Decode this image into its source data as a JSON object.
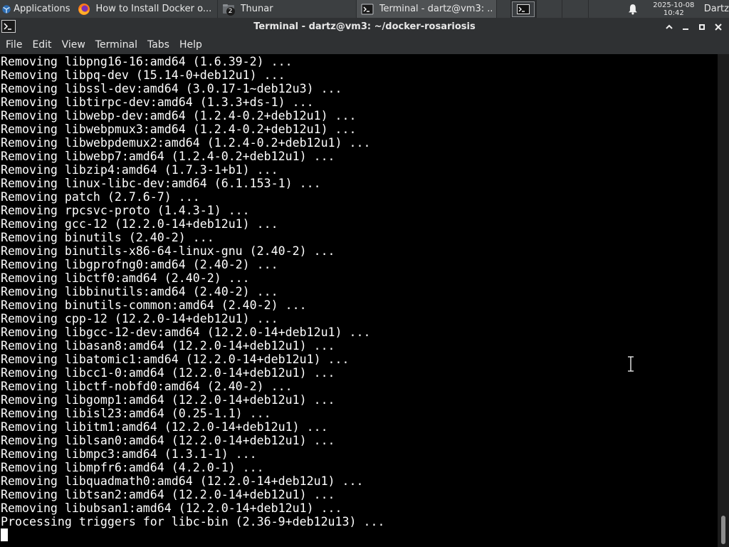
{
  "panel": {
    "applications_label": "Applications",
    "tasks": [
      {
        "label": "How to Install Docker o...",
        "icon": "firefox-icon"
      },
      {
        "label": "Thunar",
        "icon": "file-manager-icon",
        "badge": "2"
      },
      {
        "label": "Terminal - dartz@vm3: ...",
        "icon": "terminal-icon"
      }
    ],
    "date": "2025-10-08",
    "time": "10:42",
    "user": "Dartz"
  },
  "window": {
    "title": "Terminal - dartz@vm3: ~/docker-rosariosis"
  },
  "menu": [
    "File",
    "Edit",
    "View",
    "Terminal",
    "Tabs",
    "Help"
  ],
  "terminal": {
    "lines": [
      "Removing libpng16-16:amd64 (1.6.39-2) ...",
      "Removing libpq-dev (15.14-0+deb12u1) ...",
      "Removing libssl-dev:amd64 (3.0.17-1~deb12u3) ...",
      "Removing libtirpc-dev:amd64 (1.3.3+ds-1) ...",
      "Removing libwebp-dev:amd64 (1.2.4-0.2+deb12u1) ...",
      "Removing libwebpmux3:amd64 (1.2.4-0.2+deb12u1) ...",
      "Removing libwebpdemux2:amd64 (1.2.4-0.2+deb12u1) ...",
      "Removing libwebp7:amd64 (1.2.4-0.2+deb12u1) ...",
      "Removing libzip4:amd64 (1.7.3-1+b1) ...",
      "Removing linux-libc-dev:amd64 (6.1.153-1) ...",
      "Removing patch (2.7.6-7) ...",
      "Removing rpcsvc-proto (1.4.3-1) ...",
      "Removing gcc-12 (12.2.0-14+deb12u1) ...",
      "Removing binutils (2.40-2) ...",
      "Removing binutils-x86-64-linux-gnu (2.40-2) ...",
      "Removing libgprofng0:amd64 (2.40-2) ...",
      "Removing libctf0:amd64 (2.40-2) ...",
      "Removing libbinutils:amd64 (2.40-2) ...",
      "Removing binutils-common:amd64 (2.40-2) ...",
      "Removing cpp-12 (12.2.0-14+deb12u1) ...",
      "Removing libgcc-12-dev:amd64 (12.2.0-14+deb12u1) ...",
      "Removing libasan8:amd64 (12.2.0-14+deb12u1) ...",
      "Removing libatomic1:amd64 (12.2.0-14+deb12u1) ...",
      "Removing libcc1-0:amd64 (12.2.0-14+deb12u1) ...",
      "Removing libctf-nobfd0:amd64 (2.40-2) ...",
      "Removing libgomp1:amd64 (12.2.0-14+deb12u1) ...",
      "Removing libisl23:amd64 (0.25-1.1) ...",
      "Removing libitm1:amd64 (12.2.0-14+deb12u1) ...",
      "Removing liblsan0:amd64 (12.2.0-14+deb12u1) ...",
      "Removing libmpc3:amd64 (1.3.1-1) ...",
      "Removing libmpfr6:amd64 (4.2.0-1) ...",
      "Removing libquadmath0:amd64 (12.2.0-14+deb12u1) ...",
      "Removing libtsan2:amd64 (12.2.0-14+deb12u1) ...",
      "Removing libubsan1:amd64 (12.2.0-14+deb12u1) ...",
      "Processing triggers for libc-bin (2.36-9+deb12u13) ..."
    ]
  }
}
